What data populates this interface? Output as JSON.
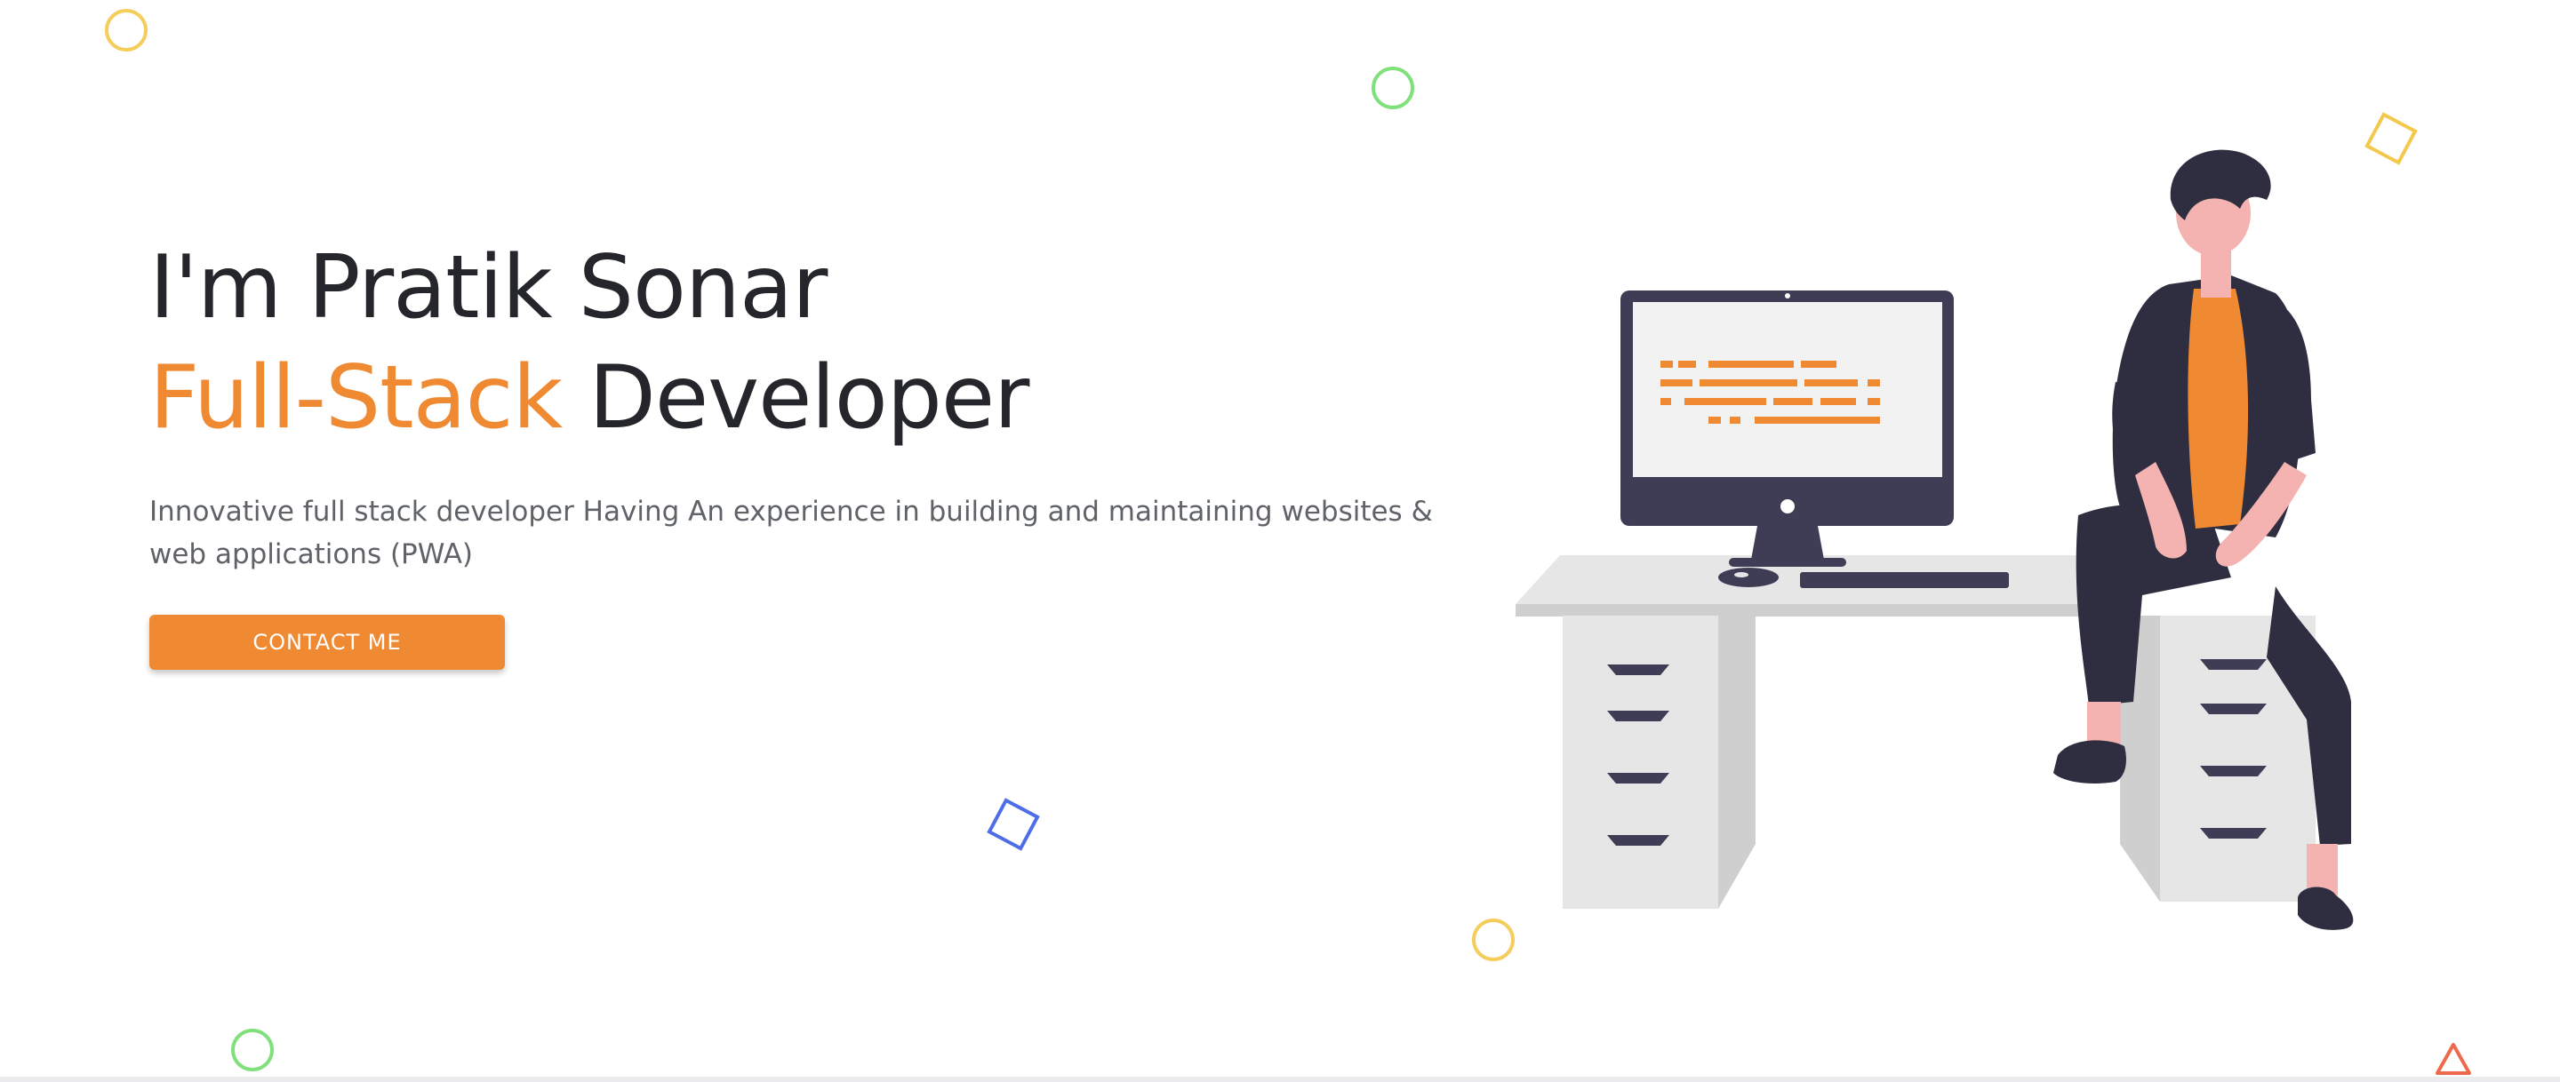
{
  "hero": {
    "greeting": "I'm Pratik Sonar",
    "role_accent": "Full-Stack",
    "role_rest": " Developer",
    "description": "Innovative full stack developer Having An experience in building and maintaining websites & web applications (PWA)",
    "cta_label": "CONTACT ME"
  },
  "illustration": {
    "icon": "developer-at-desk-illustration"
  },
  "decorations": [
    {
      "shape": "circle-outline",
      "color": "#f5cd5a"
    },
    {
      "shape": "circle-outline",
      "color": "#7fe07c"
    },
    {
      "shape": "square-outline",
      "color": "#f3c84b"
    },
    {
      "shape": "square-outline",
      "color": "#4e6de6"
    },
    {
      "shape": "circle-outline",
      "color": "#f5cd5a"
    },
    {
      "shape": "circle-outline",
      "color": "#7fe07c"
    },
    {
      "shape": "triangle-outline",
      "color": "#ee6a4d"
    }
  ],
  "colors": {
    "accent": "#ef8a33",
    "text_dark": "#25262b",
    "text_muted": "#5f6368",
    "figure_dark": "#2f2e41",
    "skin": "#f4b3b0",
    "desk": "#e6e6e6"
  }
}
